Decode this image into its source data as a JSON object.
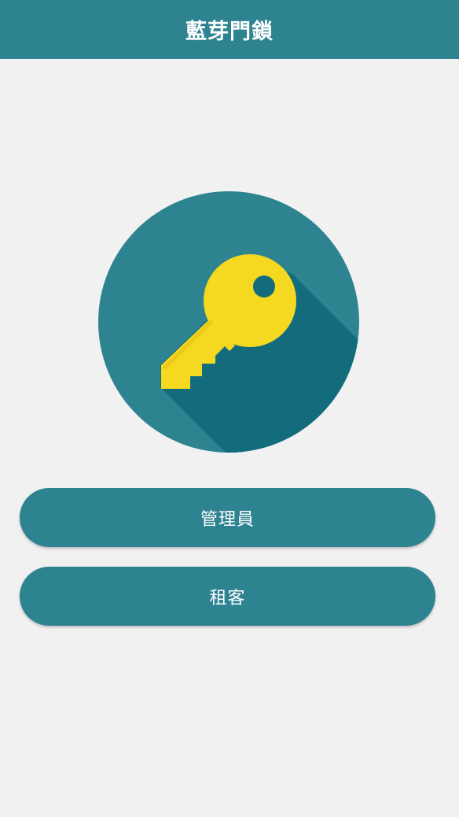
{
  "app_bar": {
    "title": "藍芽門鎖"
  },
  "logo": {
    "icon": "key-icon",
    "circle_color": "#2e8391",
    "shadow_color": "#126c7c",
    "key_color": "#f5d820"
  },
  "buttons": {
    "admin_label": "管理員",
    "tenant_label": "租客"
  },
  "colors": {
    "primary": "#2e8391",
    "background": "#f1f1f1"
  }
}
